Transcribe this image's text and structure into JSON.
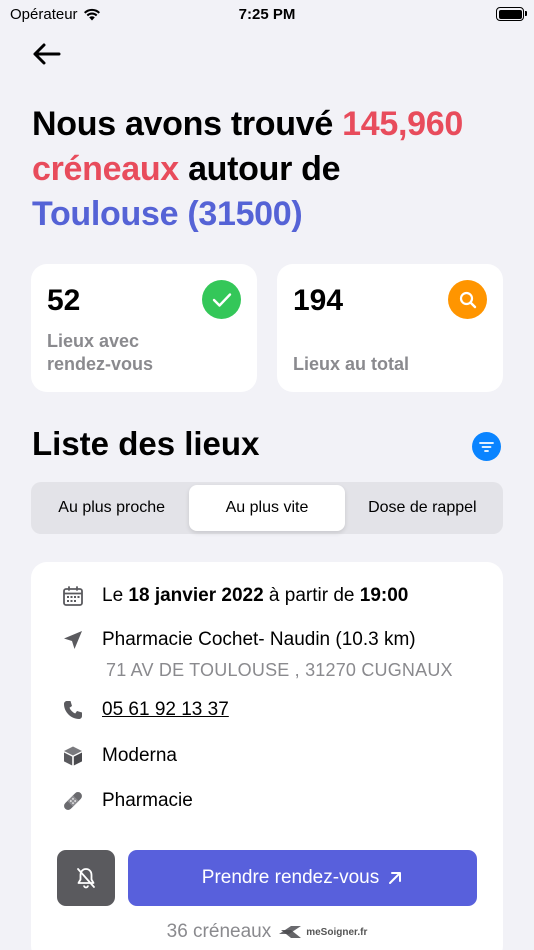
{
  "status_bar": {
    "carrier": "Opérateur",
    "time": "7:25 PM"
  },
  "headline": {
    "part1": "Nous avons trouvé ",
    "count": "145,960",
    "part2": "créneaux",
    "part3": " autour de ",
    "city": "Toulouse (31500)"
  },
  "stats": [
    {
      "value": "52",
      "label_line1": "Lieux avec",
      "label_line2": "rendez-vous",
      "badge_icon": "check-icon"
    },
    {
      "value": "194",
      "label_line1": "Lieux au total",
      "badge_icon": "search-icon"
    }
  ],
  "section_title": "Liste des lieux",
  "tabs": [
    "Au plus proche",
    "Au plus vite",
    "Dose de rappel"
  ],
  "selected_tab": "Au plus vite",
  "result": {
    "date_prefix": "Le ",
    "date": "18 janvier 2022",
    "date_mid": " à partir de ",
    "time": "19:00",
    "name": "Pharmacie Cochet- Naudin (10.3 km)",
    "address": "71 AV DE TOULOUSE , 31270 CUGNAUX",
    "phone": "05 61 92 13 37",
    "vaccine": "Moderna",
    "type": "Pharmacie",
    "book_label": "Prendre rendez-vous",
    "slots": "36 créneaux",
    "platform": "meSoigner.fr"
  },
  "colors": {
    "accent_red": "#e84c5c",
    "accent_blue": "#5563d6",
    "button": "#5860dc",
    "green": "#34c759",
    "orange": "#ff9500"
  }
}
